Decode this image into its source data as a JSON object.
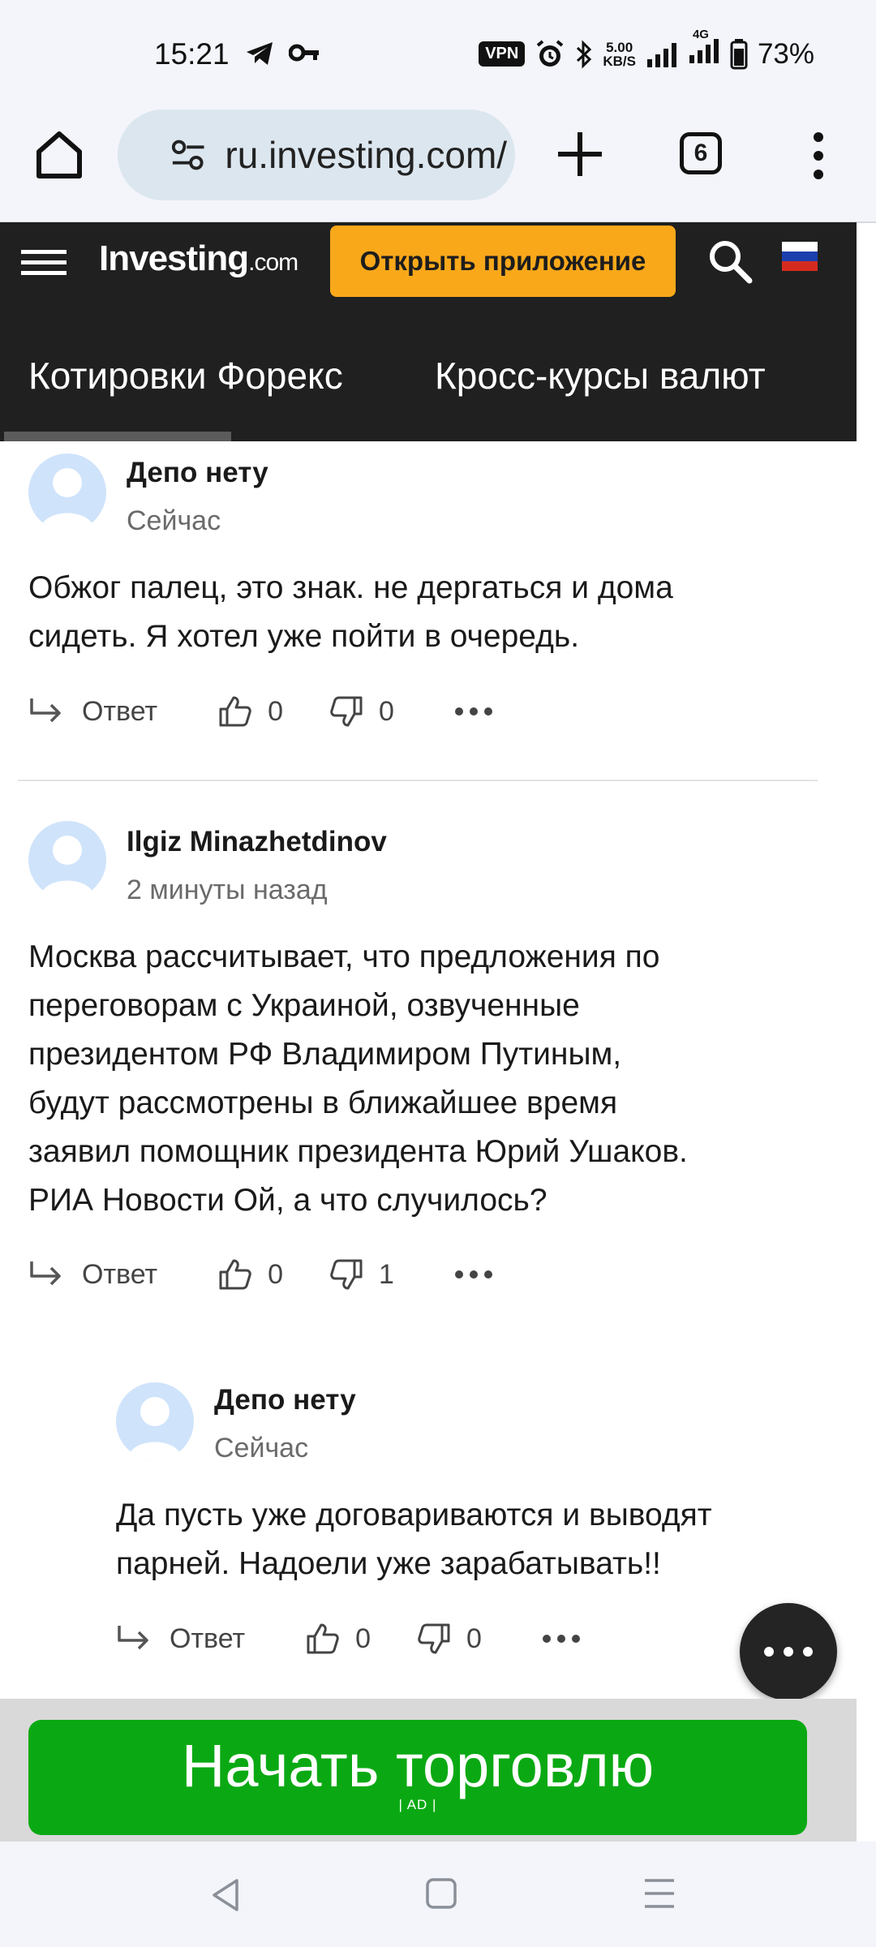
{
  "status_bar": {
    "time": "15:21",
    "vpn": "VPN",
    "speed_value": "5.00",
    "speed_unit": "KB/S",
    "network": "4G",
    "battery": "73%"
  },
  "browser": {
    "url": "ru.investing.com/",
    "tab_count": "6"
  },
  "site": {
    "logo_main": "Investing",
    "logo_suffix": ".com",
    "open_app_label": "Открыть приложение",
    "tabs": [
      {
        "label": "Котировки Форекс"
      },
      {
        "label": "Кросс-курсы валют"
      }
    ]
  },
  "comments": [
    {
      "author": "Депо нету",
      "time": "Сейчас",
      "lines": [
        "Обжог палец, это знак. не дергаться и дома",
        "сидеть. Я хотел уже пойти в очередь."
      ],
      "reply_label": "Ответ",
      "likes": "0",
      "dislikes": "0"
    },
    {
      "author": "Ilgiz Minazhetdinov",
      "time": "2 минуты назад",
      "lines": [
        "Москва рассчитывает, что предложения по",
        "переговорам с Украиной, озвученные",
        "президентом РФ Владимиром Путиным,",
        "будут рассмотрены в ближайшее время",
        "заявил помощник президента Юрий Ушаков.",
        "РИА Новости Ой, а что случилось?"
      ],
      "reply_label": "Ответ",
      "likes": "0",
      "dislikes": "1"
    },
    {
      "author": "Депо нету",
      "time": "Сейчас",
      "lines": [
        "Да пусть уже договариваются и выводят",
        "парней. Надоели уже зарабатывать!!"
      ],
      "reply_label": "Ответ",
      "likes": "0",
      "dislikes": "0"
    }
  ],
  "ad": {
    "label": "Начать торговлю",
    "tag": "| AD |"
  },
  "colors": {
    "accent_orange": "#f9a81a",
    "ad_green": "#0aa913",
    "header_dark": "#202020"
  }
}
